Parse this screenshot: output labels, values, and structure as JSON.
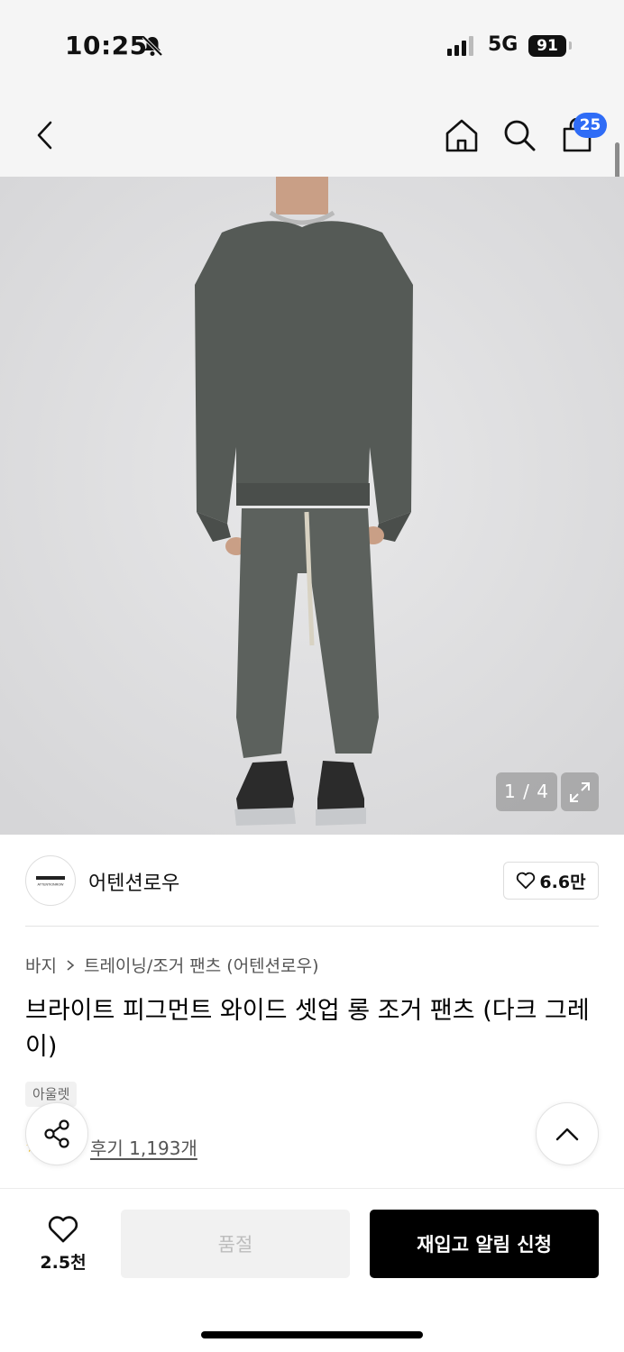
{
  "status_bar": {
    "time": "10:25",
    "network": "5G",
    "battery": "91"
  },
  "nav": {
    "back_icon": "chevron-left-icon",
    "home_icon": "home-icon",
    "search_icon": "search-icon",
    "cart_icon": "shopping-bag-icon",
    "cart_count": "25"
  },
  "gallery": {
    "counter": "1 / 4",
    "expand_icon": "expand-icon"
  },
  "brand": {
    "logo_text": "ATTENTIONROW",
    "name": "어텐션로우",
    "like_count": "6.6만"
  },
  "product": {
    "breadcrumb": [
      "바지",
      "트레이닝/조거 팬츠 (어텐션로우)"
    ],
    "title": "브라이트 피그먼트 와이드 셋업 롱 조거 팬츠 (다크 그레이)",
    "tag": "아울렛",
    "review_label": "후기 1,193개"
  },
  "bottom_bar": {
    "wish_count": "2.5천",
    "soldout_label": "품절",
    "restock_label": "재입고 알림 신청"
  },
  "colors": {
    "badge": "#2f6cf6",
    "primary_button": "#000000",
    "disabled_button": "#f1f1f1",
    "hero_bg": "#ddddde"
  }
}
